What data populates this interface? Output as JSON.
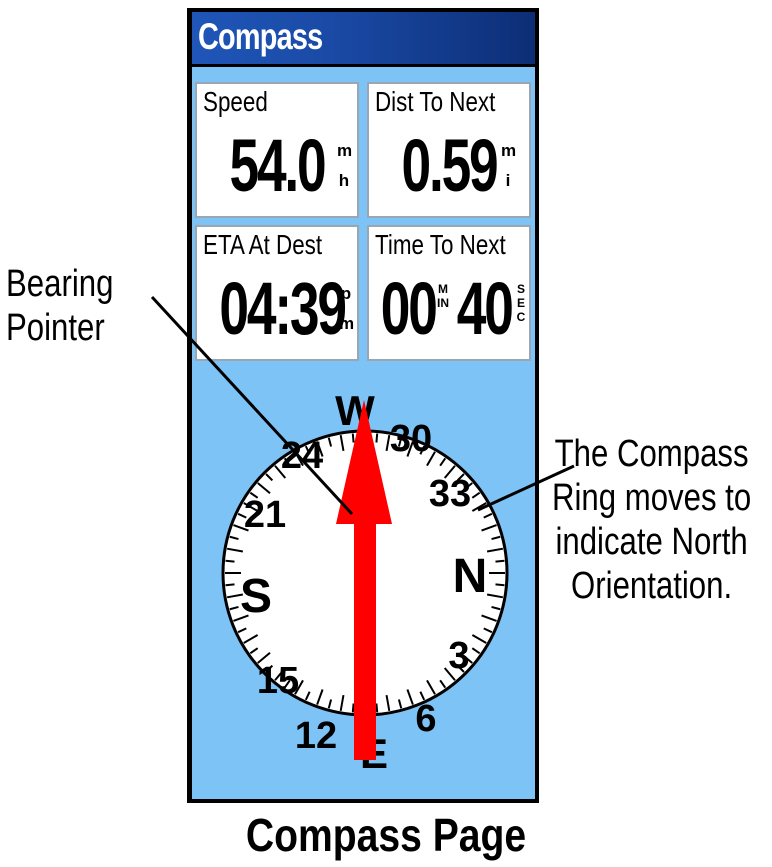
{
  "screen": {
    "title": "Compass"
  },
  "fields": [
    {
      "label": "Speed",
      "value": "54.0",
      "unit_top": "m",
      "unit_bottom": "h"
    },
    {
      "label": "Dist To Next",
      "value": "0.59",
      "unit_top": "m",
      "unit_bottom": "i"
    },
    {
      "label": "ETA At Dest",
      "value": "04:39",
      "unit_top": "p",
      "unit_bottom": "m"
    },
    {
      "label": "Time To Next",
      "value": "00",
      "unit_top": "MIN",
      "value2": "40",
      "unit2": "SEC"
    }
  ],
  "compass": {
    "cardinals": {
      "north": "N",
      "south": "S",
      "west": "W",
      "east": "E"
    },
    "ticks": {
      "three": "3",
      "six": "6",
      "twelve": "12",
      "fifteen": "15",
      "twentyone": "21",
      "twentyfour": "24",
      "thirty": "30",
      "thirtythree": "33"
    },
    "pointer_color": "#ff0000"
  },
  "callouts": {
    "left_line1": "Bearing",
    "left_line2": "Pointer",
    "right_line1": "The Compass",
    "right_line2": "Ring moves to",
    "right_line3": "indicate North",
    "right_line4": "Orientation."
  },
  "caption": "Compass Page"
}
